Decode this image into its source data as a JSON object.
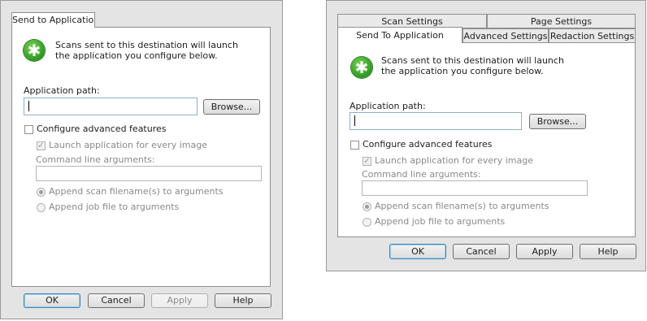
{
  "left_dialog": {
    "tabs": [
      "Send to Application"
    ],
    "description": "Scans sent to this destination will launch the application you configure below.",
    "app_path_label": "Application path:",
    "app_path_value": "",
    "browse_label": "Browse...",
    "configure_label": "Configure advanced features",
    "launch_label": "Launch application for every image",
    "cmdline_label": "Command line arguments:",
    "append_scan_label": "Append scan filename(s) to arguments",
    "append_job_label": "Append job file to arguments",
    "buttons": {
      "ok": "OK",
      "cancel": "Cancel",
      "apply": "Apply",
      "help": "Help"
    }
  },
  "right_dialog": {
    "tabs_back": [
      "Scan Settings",
      "Page Settings"
    ],
    "tabs_front": [
      "Send To Application",
      "Advanced Settings",
      "Redaction Settings"
    ],
    "description": "Scans sent to this destination will launch the application you configure below.",
    "app_path_label": "Application path:",
    "app_path_value": "",
    "browse_label": "Browse...",
    "configure_label": "Configure advanced features",
    "launch_label": "Launch application for every image",
    "cmdline_label": "Command line arguments:",
    "append_scan_label": "Append scan filename(s) to arguments",
    "append_job_label": "Append job file to arguments",
    "buttons": {
      "ok": "OK",
      "cancel": "Cancel",
      "apply": "Apply",
      "help": "Help"
    }
  },
  "states": {
    "configure_checked": false,
    "launch_checked": true,
    "append_scan_selected": true
  },
  "colors": {
    "icon_green": "#3aa52a",
    "focus_border": "#3c7fb1"
  }
}
